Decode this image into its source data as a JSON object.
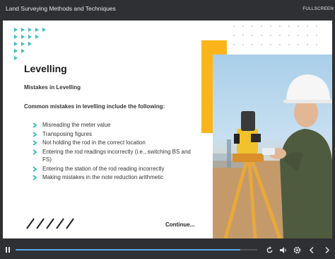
{
  "app": {
    "course_title": "Land Surveying Methods and Techniques",
    "fullscreen_label": "FULLSCREEN"
  },
  "slide": {
    "heading": "Levelling",
    "subheading": "Mistakes in Levelling",
    "intro": "Common mistakes in levelling include the following:",
    "bullets": [
      "Misreading the meter value",
      "Transposing figures",
      "Not holding the rod in the correct location",
      "Entering the rod readings incorrectly (i.e., switching BS and FS)",
      "Entering the station of the rod reading incorrectly",
      "Making mistakes in the note reduction arithmetic"
    ],
    "continue_label": "Continue...",
    "photo_alt": "surveyor-with-theodolite"
  },
  "player": {
    "progress_fraction": 0.93
  },
  "colors": {
    "accent_teal": "#3bbfc4",
    "accent_yellow": "#fbb51b",
    "chrome_bg": "#2f3033",
    "progress": "#5aa9e6"
  },
  "icons": [
    "pause-icon",
    "replay-icon",
    "volume-icon",
    "settings-icon",
    "previous-icon",
    "next-icon",
    "chevron-right-icon"
  ]
}
